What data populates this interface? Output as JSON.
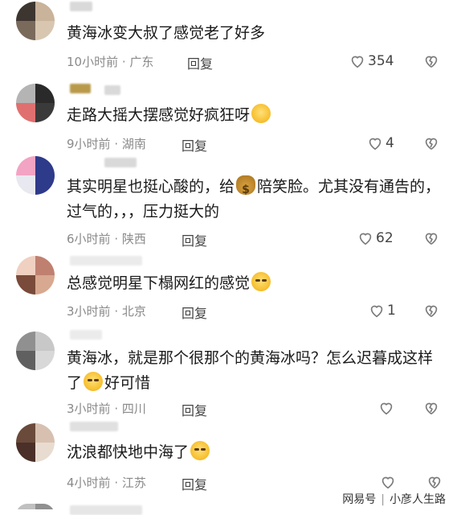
{
  "comments": [
    {
      "text": "黄海冰变大叔了感觉老了好多",
      "time": "10小时前",
      "location": "广东",
      "reply": "回复",
      "likes": "354",
      "emoji": "",
      "avatar": [
        "#3d3530",
        "#c9b39a",
        "#7a6a5c",
        "#d8c6b0"
      ]
    },
    {
      "text": "走路大摇大摆感觉好疯狂呀",
      "time": "9小时前",
      "location": "湖南",
      "reply": "回复",
      "likes": "4",
      "emoji": "smile",
      "avatar": [
        "#b4b4b4",
        "#2a2a2a",
        "#e07070",
        "#3a3a3a"
      ]
    },
    {
      "text": "其实明星也挺心酸的，给",
      "text2": "陪笑脸。尤其没有通告的，过气的，，，压力挺大的",
      "time": "6小时前",
      "location": "陕西",
      "reply": "回复",
      "likes": "62",
      "emoji": "bag",
      "avatar": [
        "#f3a3c3",
        "#2e3a8a",
        "#e8e8f0",
        "#2e3a8a"
      ]
    },
    {
      "text": "总感觉明星下榻网红的感觉",
      "time": "3小时前",
      "location": "北京",
      "reply": "回复",
      "likes": "1",
      "emoji": "cry",
      "avatar": [
        "#f0d0c0",
        "#c08070",
        "#7a4a3a",
        "#d8a890"
      ]
    },
    {
      "text": "黄海冰，就是那个很那个的黄海冰吗？怎么迟暮成这样了",
      "text2": "好可惜",
      "time": "3小时前",
      "location": "四川",
      "reply": "回复",
      "likes": "",
      "emoji": "cry",
      "avatar": [
        "#909090",
        "#c8c8c8",
        "#606060",
        "#d8d8d8"
      ]
    },
    {
      "text": "沈浪都快地中海了",
      "time": "4小时前",
      "location": "江苏",
      "reply": "回复",
      "likes": "",
      "emoji": "cry",
      "avatar": [
        "#6a4a3a",
        "#d8c0b0",
        "#4a3028",
        "#e8dcd0"
      ]
    }
  ],
  "meta_separator": " · ",
  "watermark": {
    "brand": "网易号",
    "author": "小彦人生路"
  },
  "colors": {
    "heart": "#7a7a7a",
    "meta": "#8a8a8a",
    "text": "#1a1a1a"
  }
}
